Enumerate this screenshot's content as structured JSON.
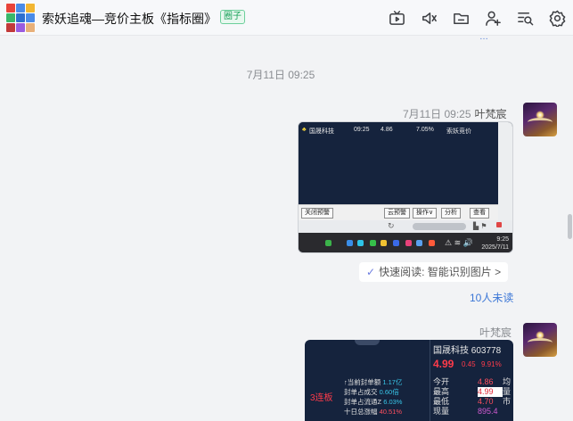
{
  "header": {
    "title": "索妖追魂—竞价主板《指标圈》",
    "tag": "圈子",
    "avatar_colors": [
      "#e8443a",
      "#4a8be8",
      "#f2b632",
      "#3ab76a",
      "#e8443a",
      "#4a8be8",
      "#f2b632",
      "#9a5ce0",
      "#e87a3a"
    ],
    "icons": [
      "tv-icon",
      "volume-icon",
      "folder-icon",
      "add-user-icon",
      "search-list-icon",
      "gear-icon"
    ]
  },
  "timestamp_center": "7月11日 09:25",
  "message1": {
    "time": "7月11日 09:25",
    "sender": "叶梵宸",
    "image": {
      "row": {
        "name": "国晟科技",
        "time": "09:25",
        "price": "4.86",
        "pct": "7.05%",
        "label": "索妖竞价"
      },
      "buttons": {
        "close": "关闭预警",
        "cloud": "云预警",
        "op": "操作∨",
        "analyze": "分析",
        "view": "查看"
      },
      "clock_time": "9:25",
      "clock_date": "2025/7/11"
    },
    "quick_read": "快速阅读: 智能识别图片 >",
    "unread": "10人未读"
  },
  "message2": {
    "sender": "叶梵宸",
    "image": {
      "stock": "国晟科技  603778",
      "price": "4.99",
      "change": "0.45",
      "change_pct": "9.91%",
      "lianban": "3连板",
      "lines": [
        {
          "label": "↑当前封单额",
          "value": "1.17亿"
        },
        {
          "label": "封单占成交",
          "value": "0.60倍"
        },
        {
          "label": "封单占流通Z",
          "value": "6.03%"
        },
        {
          "label": "十日总涨幅",
          "value": "40.51%"
        }
      ],
      "table": [
        {
          "k": "今开",
          "v": "4.86",
          "x": "均"
        },
        {
          "k": "最高",
          "v": "4.99",
          "x": "量"
        },
        {
          "k": "最低",
          "v": "4.70",
          "x": "市"
        },
        {
          "k": "现量",
          "v": "895.4",
          "x": ""
        }
      ]
    }
  },
  "partial_top": "…"
}
